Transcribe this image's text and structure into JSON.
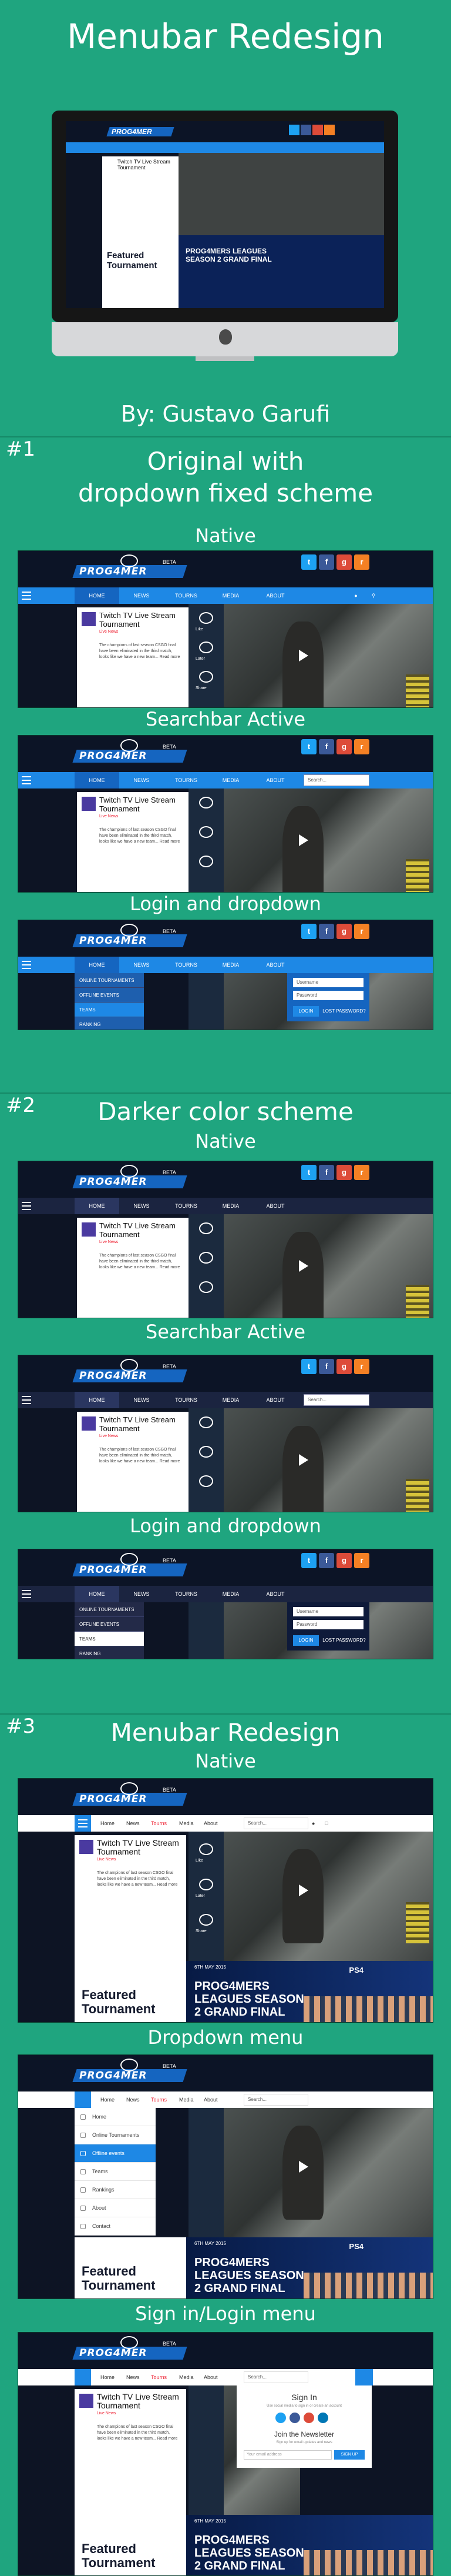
{
  "header": {
    "title": "Menubar Redesign",
    "author": "By: Gustavo Garufi"
  },
  "sections": [
    {
      "number": "#1",
      "title_line1": "Original with",
      "title_line2": "dropdown fixed scheme",
      "captions": [
        "Native",
        "Searchbar Active",
        "Login and dropdown"
      ]
    },
    {
      "number": "#2",
      "title": "Darker color scheme",
      "captions": [
        "Native",
        "Searchbar Active",
        "Login and dropdown"
      ]
    },
    {
      "number": "#3",
      "title": "Menubar Redesign",
      "captions": [
        "Native",
        "Dropdown menu",
        "Sign in/Login menu"
      ]
    }
  ],
  "site": {
    "logo": "PROG4MER",
    "beta": "BETA",
    "nav": [
      "HOME",
      "NEWS",
      "TOURNS",
      "MEDIA",
      "ABOUT"
    ],
    "nav_redesign": [
      "Home",
      "News",
      "Tourns",
      "Media",
      "About"
    ],
    "search_placeholder": "Search...",
    "article_title": "Twitch TV Live Stream Tournament",
    "article_date": "Live News",
    "article_body": "The champions of last season CSGO final have been eliminated in the third match, looks like we have a new team... Read more",
    "video_labels": [
      "Like",
      "Later",
      "Share"
    ],
    "featured": "Featured Tournament",
    "banner_date": "6TH MAY 2015",
    "banner_title": "PROG4MERS LEAGUES SEASON 2 GRAND FINAL",
    "banner_brand": "PS4"
  },
  "dropdown_items": [
    "ONLINE TOURNAMENTS",
    "OFFLINE EVENTS",
    "TEAMS",
    "RANKING"
  ],
  "login": {
    "username": "Username",
    "password": "Password",
    "login_btn": "LOGIN",
    "lost": "LOST PASSWORD?"
  },
  "dropdown2": [
    "Home",
    "Online Tournaments",
    "Offline events",
    "Teams",
    "Rankings",
    "About",
    "Contact"
  ],
  "signin": {
    "title": "Sign In",
    "subtitle": "Use social media to sign in or create an account",
    "newsletter": "Join the Newsletter",
    "newsletter_sub": "Sign up for email updates and news",
    "email": "Your email address",
    "signup": "SIGN UP"
  },
  "colors": {
    "bg": "#1fa57f",
    "accent_blue": "#1e88e5",
    "dark_nav": "#1b2440"
  }
}
